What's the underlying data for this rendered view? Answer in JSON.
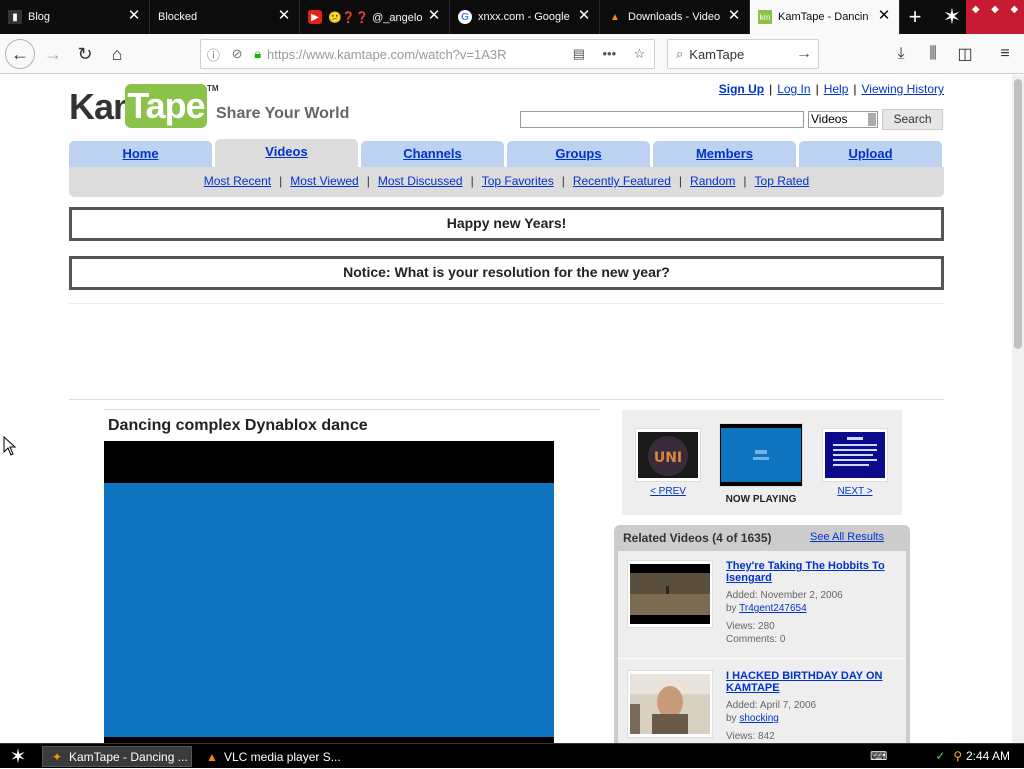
{
  "browser": {
    "tabs": [
      {
        "title": "Blog",
        "icon": "blog-icon",
        "active": false
      },
      {
        "title": "Blocked",
        "icon": "blocked-icon",
        "active": false
      },
      {
        "title": "😕❓❓ @_angelo",
        "icon": "youtube-icon",
        "active": false
      },
      {
        "title": "xnxx.com - Google",
        "icon": "google-icon",
        "active": false
      },
      {
        "title": "Downloads - Video",
        "icon": "vlc-icon",
        "active": false
      },
      {
        "title": "KamTape - Dancin",
        "icon": "kamtape-icon",
        "active": true
      }
    ],
    "url": "https://www.kamtape.com/watch?v=1A3R",
    "search_placeholder": "KamTape"
  },
  "site": {
    "logo_kam": "Kam",
    "logo_tape": "Tape",
    "logo_tm": "TM",
    "slogan": "Share Your World",
    "toplinks": {
      "signup": "Sign Up",
      "login": "Log In",
      "help": "Help",
      "history": "Viewing History"
    },
    "search": {
      "category": "Videos",
      "button": "Search"
    },
    "tabs": [
      {
        "label": "Home",
        "selected": false
      },
      {
        "label": "Videos",
        "selected": true
      },
      {
        "label": "Channels",
        "selected": false
      },
      {
        "label": "Groups",
        "selected": false
      },
      {
        "label": "Members",
        "selected": false
      },
      {
        "label": "Upload",
        "selected": false
      }
    ],
    "subnav": [
      "Most Recent",
      "Most Viewed",
      "Most Discussed",
      "Top Favorites",
      "Recently Featured",
      "Random",
      "Top Rated"
    ],
    "notices": [
      "Happy new Years!",
      "Notice: What is your resolution for the new year?"
    ]
  },
  "video": {
    "title": "Dancing complex Dynablox dance",
    "prev": "< PREV",
    "now_playing": "NOW PLAYING",
    "next": "NEXT >"
  },
  "related": {
    "heading": "Related Videos (4 of 1635)",
    "see_all": "See All Results",
    "items": [
      {
        "title": "They're Taking The Hobbits To Isengard",
        "added": "Added: November 2, 2006",
        "by_label": "by ",
        "by": "Tr4gent247654",
        "views": "Views: 280",
        "comments": "Comments: 0"
      },
      {
        "title": "I HACKED BIRTHDAY DAY ON KAMTAPE",
        "added": "Added: April 7, 2006",
        "by_label": "by ",
        "by": "shocking",
        "views": "Views: 842",
        "comments": ""
      }
    ]
  },
  "taskbar": {
    "tasks": [
      {
        "label": "KamTape - Dancing ...",
        "icon": "firefox-icon"
      },
      {
        "label": "VLC media player S...",
        "icon": "vlc-icon"
      }
    ],
    "clock": "2:44 AM"
  },
  "colors": {
    "link": "#0033cc",
    "tab_blue": "#bdd1f1",
    "logo_green": "#8bc34a",
    "player_blue": "#0f74c0"
  }
}
